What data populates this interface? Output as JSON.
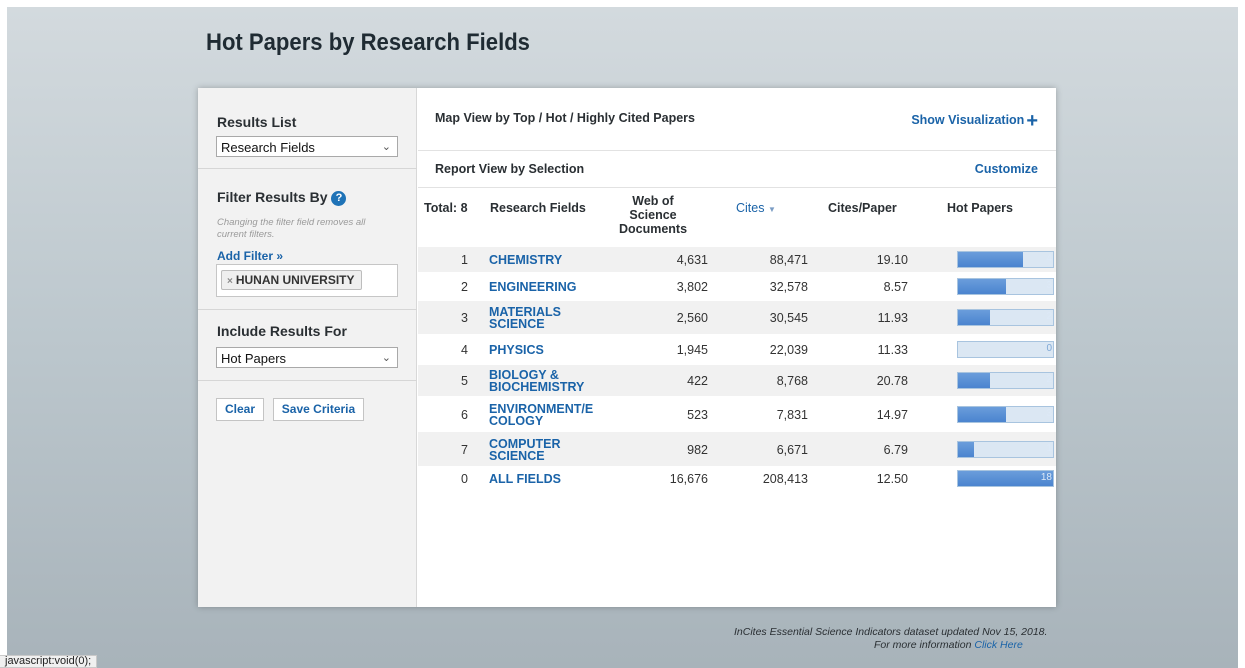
{
  "page_title": "Hot Papers by Research Fields",
  "sidebar": {
    "results_list": {
      "heading": "Results List",
      "selected": "Research Fields"
    },
    "filter": {
      "heading": "Filter Results By",
      "note": "Changing the filter field removes all current filters.",
      "add_filter": "Add Filter »",
      "chip_label": "HUNAN UNIVERSITY",
      "chip_remove": "×"
    },
    "include": {
      "heading": "Include Results For",
      "selected": "Hot Papers"
    },
    "buttons": {
      "clear": "Clear",
      "save": "Save Criteria"
    }
  },
  "main": {
    "map_view_title": "Map View by Top / Hot / Highly Cited Papers",
    "show_visualization": "Show Visualization",
    "show_visualization_icon": "+",
    "report_view_title": "Report View by Selection",
    "customize": "Customize",
    "columns": {
      "total": "Total: 8",
      "research_fields": "Research Fields",
      "wos_docs_line1": "Web of Science",
      "wos_docs_line2": "Documents",
      "cites": "Cites",
      "cites_paper": "Cites/Paper",
      "hot_papers": "Hot Papers"
    },
    "rows": [
      {
        "rank": "1",
        "field_l1": "CHEMISTRY",
        "field_l2": "",
        "docs": "4,631",
        "cites": "88,471",
        "cpp": "19.10",
        "hot_papers": 4,
        "hot_label": "4"
      },
      {
        "rank": "2",
        "field_l1": "ENGINEERING",
        "field_l2": "",
        "docs": "3,802",
        "cites": "32,578",
        "cpp": "8.57",
        "hot_papers": 3,
        "hot_label": "3"
      },
      {
        "rank": "3",
        "field_l1": "MATERIALS",
        "field_l2": "SCIENCE",
        "docs": "2,560",
        "cites": "30,545",
        "cpp": "11.93",
        "hot_papers": 2,
        "hot_label": "2"
      },
      {
        "rank": "4",
        "field_l1": "PHYSICS",
        "field_l2": "",
        "docs": "1,945",
        "cites": "22,039",
        "cpp": "11.33",
        "hot_papers": 0,
        "hot_label": "0"
      },
      {
        "rank": "5",
        "field_l1": "BIOLOGY &",
        "field_l2": "BIOCHEMISTRY",
        "docs": "422",
        "cites": "8,768",
        "cpp": "20.78",
        "hot_papers": 2,
        "hot_label": "2"
      },
      {
        "rank": "6",
        "field_l1": "ENVIRONMENT/E",
        "field_l2": "COLOGY",
        "docs": "523",
        "cites": "7,831",
        "cpp": "14.97",
        "hot_papers": 3,
        "hot_label": "3"
      },
      {
        "rank": "7",
        "field_l1": "COMPUTER",
        "field_l2": "SCIENCE",
        "docs": "982",
        "cites": "6,671",
        "cpp": "6.79",
        "hot_papers": 1,
        "hot_label": "1"
      },
      {
        "rank": "0",
        "field_l1": "ALL FIELDS",
        "field_l2": "",
        "docs": "16,676",
        "cites": "208,413",
        "cpp": "12.50",
        "hot_papers": 18,
        "hot_label": "18"
      }
    ]
  },
  "footer": {
    "line1": "InCites Essential Science Indicators dataset updated Nov 15, 2018.",
    "line2_prefix": "For more information",
    "line2_link": "Click Here"
  },
  "status_bar": "javascript:void(0);",
  "colors": {
    "link": "#1a63a8",
    "bar_fill": "#4b84cf",
    "bar_bg": "#dbe7f3",
    "help_icon": "#1f73b7"
  }
}
